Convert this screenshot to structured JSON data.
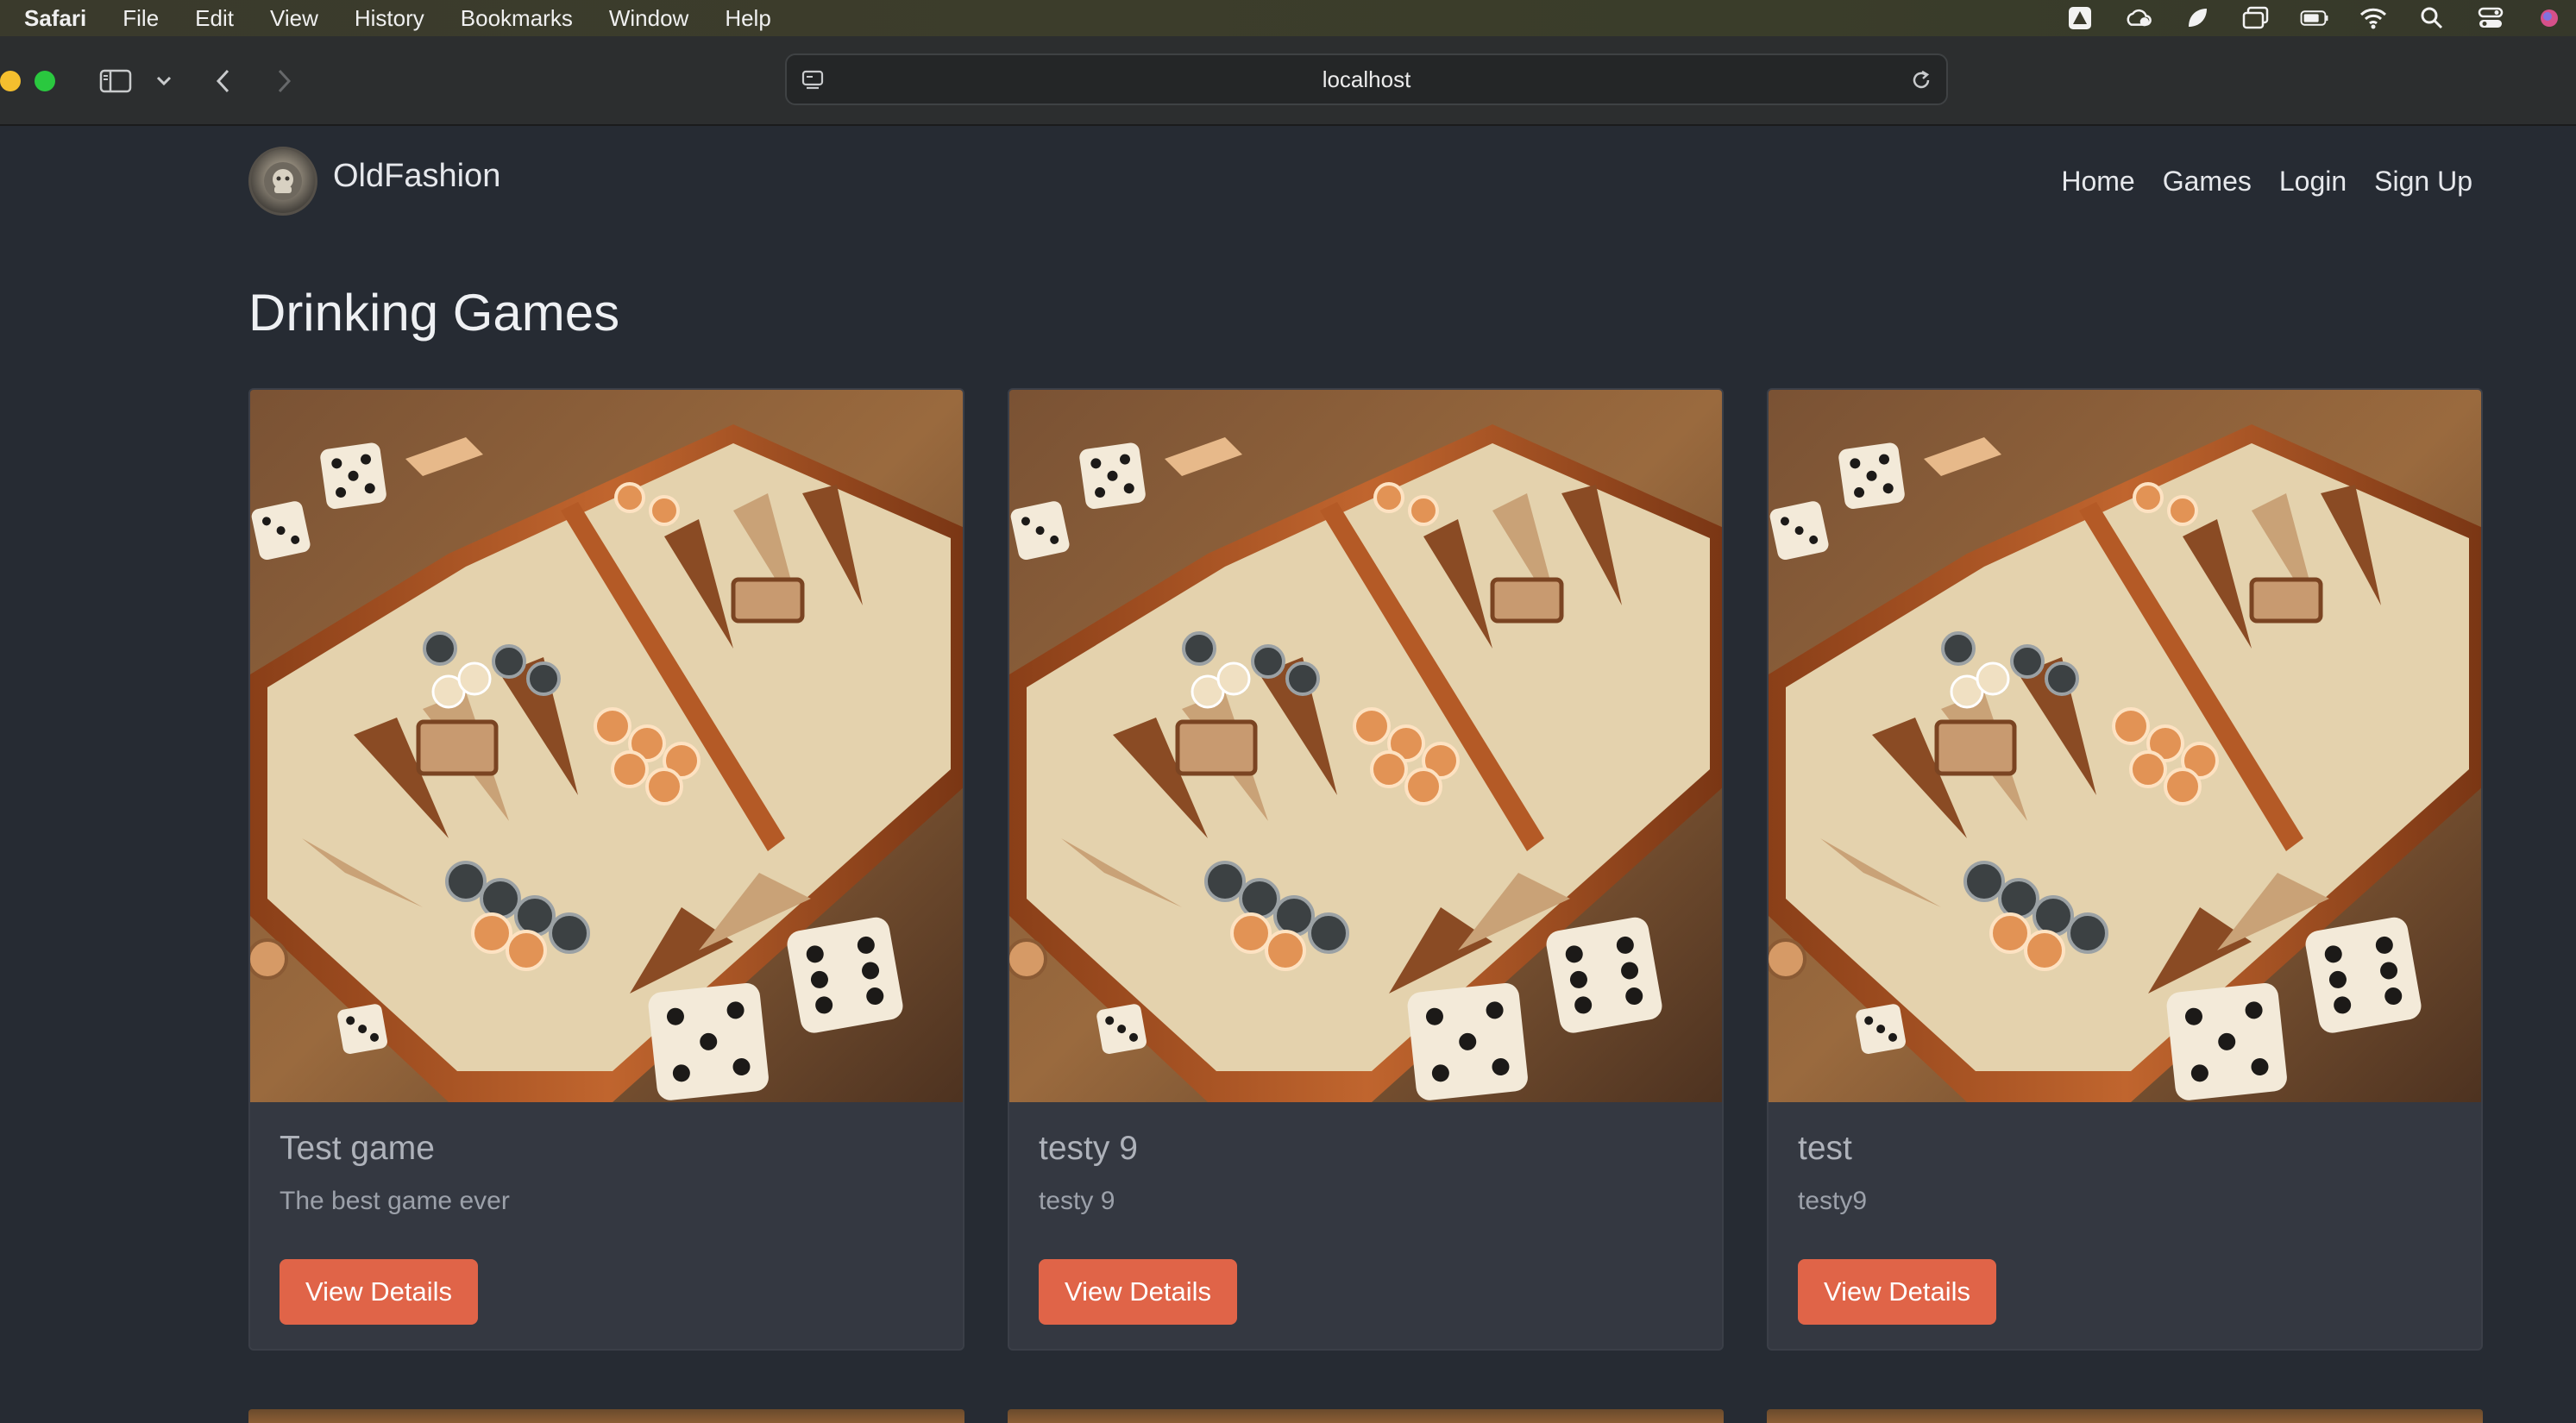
{
  "menubar": {
    "app": "Safari",
    "items": [
      "File",
      "Edit",
      "View",
      "History",
      "Bookmarks",
      "Window",
      "Help"
    ]
  },
  "browser": {
    "url": "localhost"
  },
  "site": {
    "brand": "OldFashion",
    "nav": [
      "Home",
      "Games",
      "Login",
      "Sign Up"
    ]
  },
  "page": {
    "title": "Drinking Games"
  },
  "cards": [
    {
      "title": "Test game",
      "description": "The best game ever",
      "button": "View Details"
    },
    {
      "title": "testy 9",
      "description": "testy 9",
      "button": "View Details"
    },
    {
      "title": "test",
      "description": "testy9",
      "button": "View Details"
    }
  ],
  "colors": {
    "accent": "#e06448",
    "background": "#262b33",
    "card": "#343841"
  }
}
